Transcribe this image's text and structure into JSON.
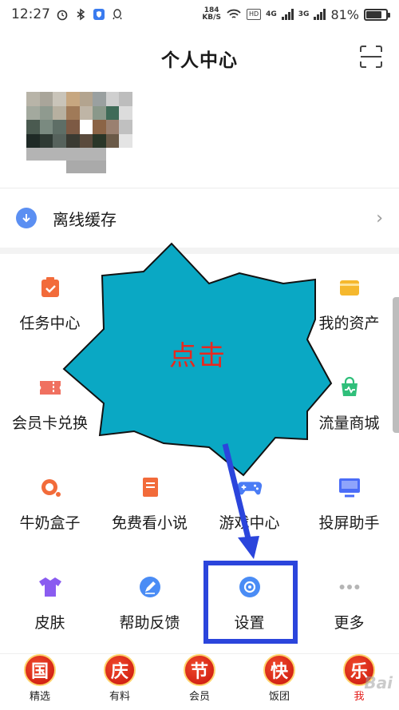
{
  "status_bar": {
    "time": "12:27",
    "net_speed_value": "184",
    "net_speed_unit": "KB/S",
    "hd_badge": "HD",
    "net_type_1": "4G",
    "net_type_2": "3G",
    "battery_percent": "81%",
    "battery_level": 0.81,
    "icons": [
      "alarm-icon",
      "bluetooth-icon",
      "shield-icon",
      "qq-icon",
      "wifi-icon",
      "signal-icon",
      "battery-icon"
    ]
  },
  "header": {
    "title": "个人中心",
    "scan_icon": "scan-icon"
  },
  "offline": {
    "label": "离线缓存",
    "icon": "download-icon"
  },
  "grid": [
    {
      "label": "任务中心",
      "icon": "task-clipboard-icon",
      "color": "#f26b3a"
    },
    {
      "label": "",
      "icon": "hidden-icon",
      "color": "#4a6cf7"
    },
    {
      "label": "",
      "icon": "hidden-icon",
      "color": "#999999"
    },
    {
      "label": "我的资产",
      "icon": "wallet-icon",
      "color": "#f5b82e"
    },
    {
      "label": "会员卡兑换",
      "icon": "ticket-icon",
      "color": "#f07060"
    },
    {
      "label": "",
      "icon": "hidden-icon",
      "color": "#999999"
    },
    {
      "label": "",
      "icon": "hidden-icon",
      "color": "#999999"
    },
    {
      "label": "流量商城",
      "icon": "shopping-bag-icon",
      "color": "#2fbf7a"
    },
    {
      "label": "牛奶盒子",
      "icon": "milk-box-icon",
      "color": "#f26b3a"
    },
    {
      "label": "免费看小说",
      "icon": "book-icon",
      "color": "#f26b3a"
    },
    {
      "label": "游戏中心",
      "icon": "gamepad-icon",
      "color": "#4a7cf5"
    },
    {
      "label": "投屏助手",
      "icon": "monitor-icon",
      "color": "#4a6cf7"
    },
    {
      "label": "皮肤",
      "icon": "tshirt-icon",
      "color": "#8a5cf0"
    },
    {
      "label": "帮助反馈",
      "icon": "pencil-icon",
      "color": "#4a8cf5"
    },
    {
      "label": "设置",
      "icon": "gear-icon",
      "color": "#4a8cf5"
    },
    {
      "label": "更多",
      "icon": "more-dots-icon",
      "color": "#b5b5b5"
    }
  ],
  "annotation": {
    "text": "点击",
    "burst_color": "#0aa8c4",
    "box_color": "#2b45dc",
    "text_color": "#e8281e"
  },
  "bottom_nav": [
    {
      "badge": "国",
      "label": "精选"
    },
    {
      "badge": "庆",
      "label": "有料"
    },
    {
      "badge": "节",
      "label": "会员"
    },
    {
      "badge": "快",
      "label": "饭团"
    },
    {
      "badge": "乐",
      "label": "我",
      "active": true
    }
  ],
  "watermark": "Bai"
}
